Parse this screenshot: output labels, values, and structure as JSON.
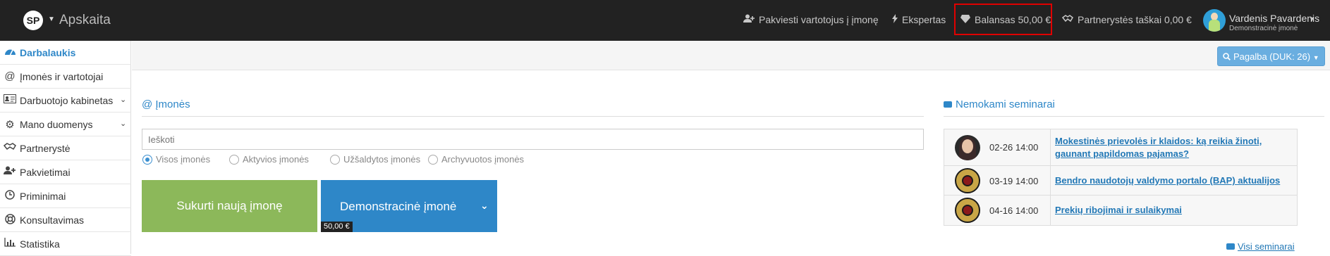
{
  "header": {
    "logo_text": "SP",
    "app_title": "Apskaita",
    "invite_label": "Pakviesti vartotojus į įmonę",
    "expert_label": "Ekspertas",
    "balance_label": "Balansas 50,00 €",
    "partnership_points_label": "Partnerystės taškai 0,00 €",
    "user_name": "Vardenis Pavardenis",
    "user_company": "Demonstracinė įmonė",
    "highlight_color": "#e00000"
  },
  "sidebar": {
    "items": [
      {
        "label": "Darbalaukis",
        "icon": "dashboard-icon"
      },
      {
        "label": "Įmonės ir vartotojai",
        "icon": "at-icon"
      },
      {
        "label": "Darbuotojo kabinetas",
        "icon": "id-card-icon"
      },
      {
        "label": "Mano duomenys",
        "icon": "gears-icon"
      },
      {
        "label": "Partnerystė",
        "icon": "handshake-icon"
      },
      {
        "label": "Pakvietimai",
        "icon": "user-plus-icon"
      },
      {
        "label": "Priminimai",
        "icon": "clock-icon"
      },
      {
        "label": "Konsultavimas",
        "icon": "lifebuoy-icon"
      },
      {
        "label": "Statistika",
        "icon": "bar-chart-icon"
      }
    ]
  },
  "help_button": "Pagalba (DUK: 26)",
  "companies": {
    "title": "@ Įmonės",
    "search_placeholder": "Ieškoti",
    "filters": [
      {
        "label": "Visos įmonės",
        "checked": true
      },
      {
        "label": "Aktyvios įmonės",
        "checked": false
      },
      {
        "label": "Užšaldytos įmonės",
        "checked": false
      },
      {
        "label": "Archyvuotos įmonės",
        "checked": false
      }
    ],
    "create_button": "Sukurti naują įmonę",
    "demo_company": {
      "name": "Demonstracinė įmonė",
      "balance": "50,00 €"
    }
  },
  "seminars": {
    "title": "Nemokami seminarai",
    "items": [
      {
        "date": "02-26 14:00",
        "title": "Mokestinės prievolės ir klaidos: ką reikia žinoti, gaunant papildomas pajamas?",
        "thumb": "person"
      },
      {
        "date": "03-19 14:00",
        "title": "Bendro naudotojų valdymo portalo (BAP) aktualijos",
        "thumb": "seal"
      },
      {
        "date": "04-16 14:00",
        "title": "Prekių ribojimai ir sulaikymai",
        "thumb": "seal"
      }
    ],
    "all_link": "Visi seminarai"
  }
}
